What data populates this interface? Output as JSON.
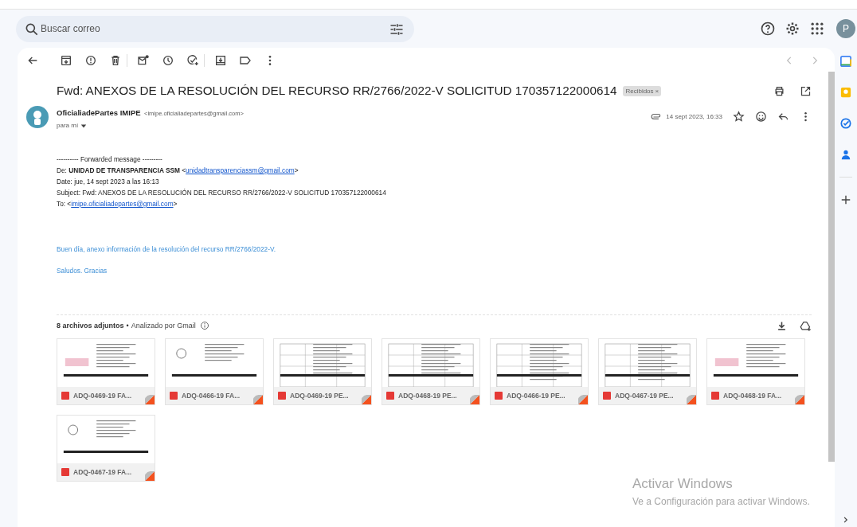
{
  "search": {
    "placeholder": "Buscar correo"
  },
  "account": {
    "initial": "P"
  },
  "message": {
    "subject": "Fwd: ANEXOS DE LA RESOLUCIÓN DEL RECURSO RR/2766/2022-V SOLICITUD 170357122000614",
    "label": {
      "text": "Recibidos",
      "close": "×"
    },
    "sender_name": "OficialiadePartes IMIPE",
    "sender_email": "<imipe.oficialiadepartes@gmail.com>",
    "recipient": "para mí",
    "date": "14 sept 2023, 16:33"
  },
  "forwarded": [
    {
      "text": "---------- Forwarded message ---------"
    },
    {
      "text": "De: **UNIDAD DE TRANSPARENCIA SSM** <",
      "link": "unidadtransparenciassm@gmail.com",
      "after": ">"
    },
    {
      "text": "Date: jue, 14 sept 2023 a las 16:13"
    },
    {
      "text": "Subject: Fwd: ANEXOS DE LA RESOLUCIÓN DEL RECURSO RR/2766/2022-V SOLICITUD 170357122000614"
    },
    {
      "text": "To: <",
      "link": "imipe.oficialiadepartes@gmail.com",
      "after": ">"
    }
  ],
  "body": [
    "Buen día, anexo información de la resolución del recurso RR/2766/2022-V.",
    "Saludos. Gracias"
  ],
  "attachments": {
    "count": "8 archivos adjuntos",
    "separator": "•",
    "scanned": "Analizado por Gmail",
    "files": [
      {
        "name": "ADQ-0469-19 FA...",
        "kind": "invoice"
      },
      {
        "name": "ADQ-0466-19 FA...",
        "kind": "letter"
      },
      {
        "name": "ADQ-0469-19 PE...",
        "kind": "form"
      },
      {
        "name": "ADQ-0468-19 PE...",
        "kind": "form"
      },
      {
        "name": "ADQ-0466-19 PE...",
        "kind": "table"
      },
      {
        "name": "ADQ-0467-19 PE...",
        "kind": "table"
      },
      {
        "name": "ADQ-0468-19 FA...",
        "kind": "invoice"
      },
      {
        "name": "ADQ-0467-19 FA...",
        "kind": "letter"
      }
    ]
  },
  "activation": {
    "title": "Activar Windows",
    "subtitle": "Ve a Configuración para activar Windows."
  }
}
